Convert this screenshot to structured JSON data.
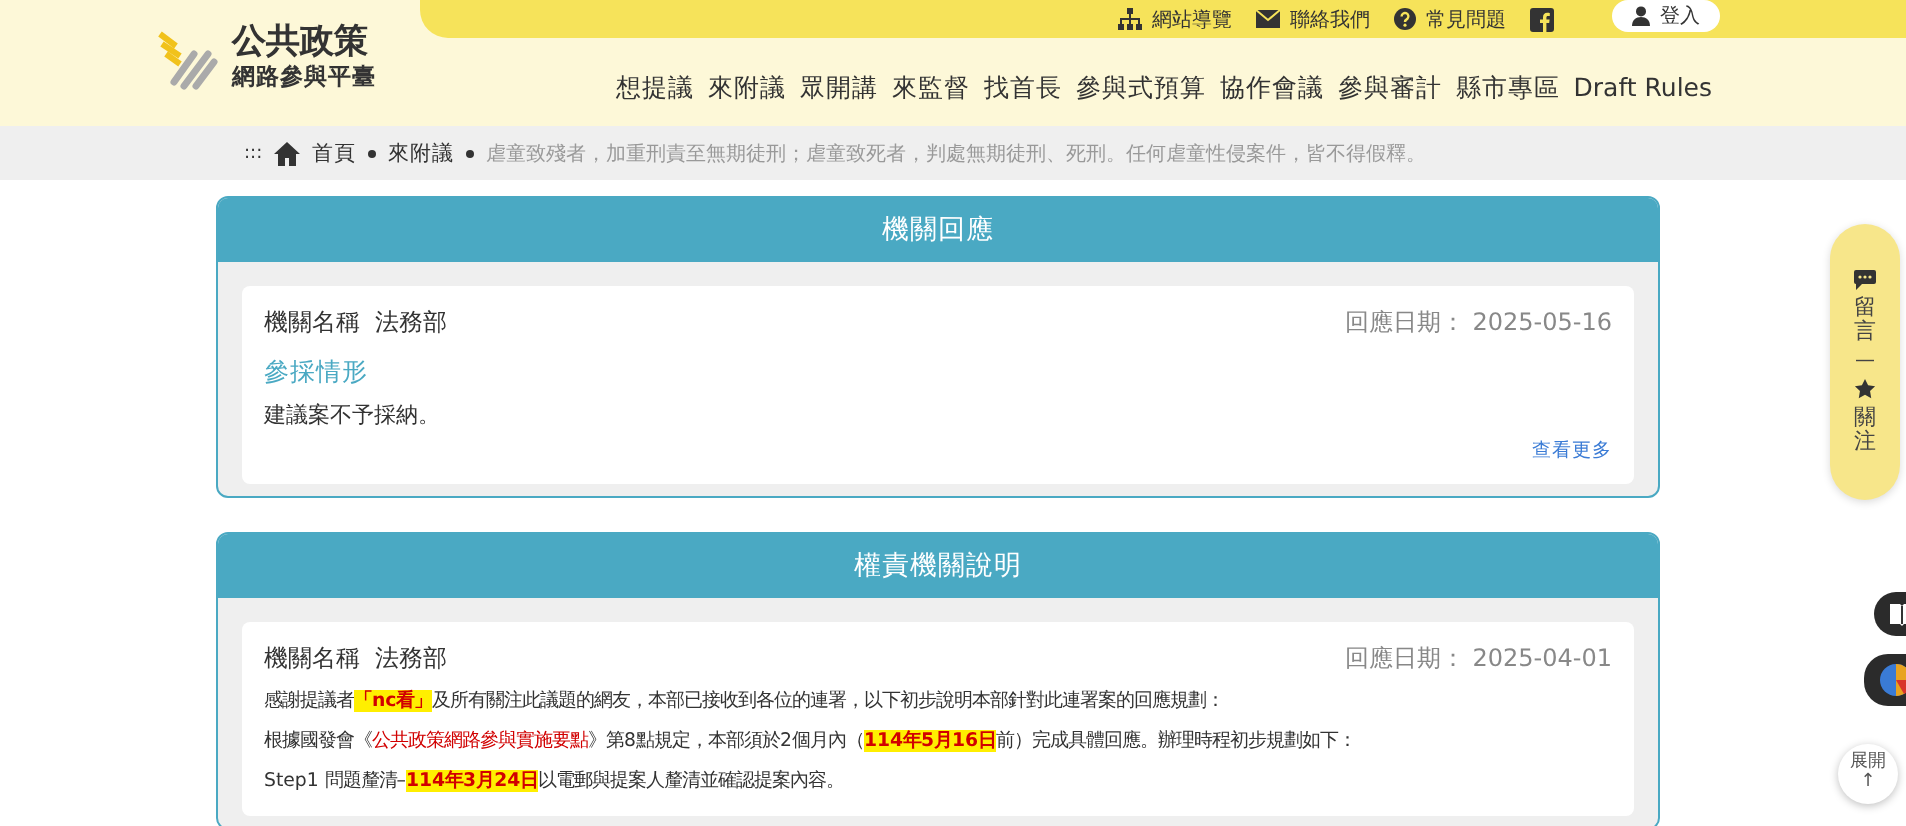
{
  "logo": {
    "title": "公共政策",
    "subtitle": "網路參與平臺"
  },
  "top_links": [
    {
      "label": "網站導覽",
      "kind": "sitemap"
    },
    {
      "label": "聯絡我們",
      "kind": "mail"
    },
    {
      "label": "常見問題",
      "kind": "help"
    }
  ],
  "login": "登入",
  "nav": [
    "想提議",
    "來附議",
    "眾開講",
    "來監督",
    "找首長",
    "參與式預算",
    "協作會議",
    "參與審計",
    "縣市專區",
    "Draft Rules"
  ],
  "breadcrumb": {
    "marker": ":::",
    "home": "首頁",
    "items": [
      "來附議"
    ],
    "current": "虐童致殘者，加重刑責至無期徒刑；虐童致死者，判處無期徒刑、死刑。任何虐童性侵案件，皆不得假釋。"
  },
  "panels": [
    {
      "title": "機關回應",
      "agency_label": "機關名稱",
      "agency": "法務部",
      "date_label": "回應日期：",
      "date": "2025-05-16",
      "subheading": "參採情形",
      "paragraphs": [
        [
          {
            "kind": "plain",
            "text": "建議案不予採納。"
          }
        ]
      ],
      "more": "查看更多"
    },
    {
      "title": "權責機關說明",
      "agency_label": "機關名稱",
      "agency": "法務部",
      "date_label": "回應日期：",
      "date": "2025-04-01",
      "paragraphs": [
        [
          {
            "kind": "plain",
            "text": "感謝提議者"
          },
          {
            "kind": "highlight",
            "text": "「nc看」"
          },
          {
            "kind": "plain",
            "text": "及所有關注此議題的網友，本部已接收到各位的連署，以下初步說明本部針對此連署案的回應規劃："
          }
        ],
        [
          {
            "kind": "plain",
            "text": "根據國發會《"
          },
          {
            "kind": "link",
            "text": "公共政策網路參與實施要點"
          },
          {
            "kind": "plain",
            "text": "》第8點規定，本部須於2個月內（"
          },
          {
            "kind": "highlight",
            "text": "114年5月16日"
          },
          {
            "kind": "plain",
            "text": "前）完成具體回應。辦理時程初步規劃如下："
          }
        ],
        [
          {
            "kind": "plain",
            "text": "Step1 問題釐清–"
          },
          {
            "kind": "highlight",
            "text": "114年3月24日"
          },
          {
            "kind": "plain",
            "text": "以電郵與提案人釐清並確認提案內容。"
          }
        ]
      ]
    }
  ],
  "side_actions": [
    {
      "label": "留言",
      "kind": "comment"
    },
    {
      "label": "關注",
      "kind": "star"
    }
  ],
  "side_divider": "—",
  "expand": {
    "label": "展開",
    "arrow": "↑"
  }
}
